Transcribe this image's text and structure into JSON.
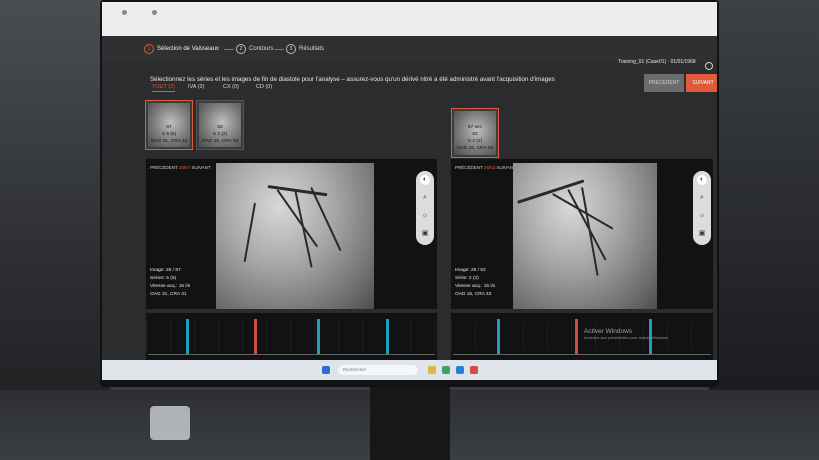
{
  "steps": [
    {
      "num": "1",
      "label": "Sélection de Vaisseaux"
    },
    {
      "num": "2",
      "label": "Contours"
    },
    {
      "num": "3",
      "label": "Résultats"
    }
  ],
  "study": "Training_01 (Case01) · 01/01/1968",
  "instruction": "Sélectionnez les séries et les images de fin de diastole pour l'analyse – assurez-vous qu'un dérivé nitré a été administré avant l'acquisition d'images",
  "buttons": {
    "prev": "PRÉCÉDENT",
    "next": "SUIVANT"
  },
  "tabs": [
    "TOUT (2)",
    "IVA (2)",
    "CX (0)",
    "CD (0)"
  ],
  "thumbs": [
    {
      "l1": "67",
      "l2": "S 5 (5)",
      "l3": "OAG 31, CRA 31"
    },
    {
      "l1": "53",
      "l2": "S 2 (2)",
      "l3": "OAD 15, CRA 33"
    },
    {
      "l1": "67 sec",
      "l2": "53",
      "l3": "S 2 (2)",
      "l4": "OAD 15, CRA 33"
    }
  ],
  "left_panel": {
    "prev": "PRÉCÉDENT",
    "count": "25/67",
    "next": "SUIVANT",
    "meta": [
      "Image: 25 / 67",
      "Séries: 5 (5)",
      "Vitesse acq.: 15 i/s",
      "OAG 31, CRA 31"
    ]
  },
  "right_panel": {
    "prev": "PRÉCÉDENT",
    "count": "25/53",
    "next": "SUIVANT",
    "meta": [
      "Image: 25 / 53",
      "Série: 2 (2)",
      "Vitesse acq.: 15 i/s",
      "OAD 15, CRA 33"
    ]
  },
  "watermark": {
    "title": "Activer Windows",
    "sub": "Accédez aux paramètres pour activer Windows."
  },
  "taskbar": {
    "search": "Rechercher"
  },
  "colors": {
    "accent": "#e05a3c",
    "marker_blue": "#1f9fb8",
    "marker_red": "#c8503a"
  }
}
